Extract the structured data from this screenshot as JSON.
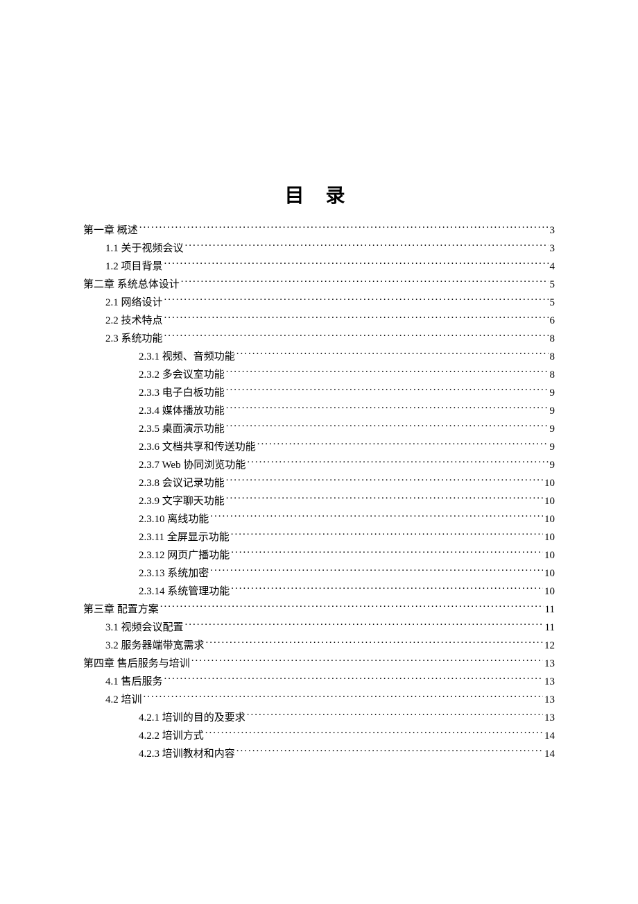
{
  "title": "目 录",
  "entries": [
    {
      "level": 0,
      "label": "第一章  概述",
      "page": "3"
    },
    {
      "level": 1,
      "label": "1.1 关于视频会议",
      "page": "3"
    },
    {
      "level": 1,
      "label": "1.2 项目背景",
      "page": "4"
    },
    {
      "level": 0,
      "label": "第二章  系统总体设计",
      "page": "5"
    },
    {
      "level": 1,
      "label": "2.1 网络设计",
      "page": "5"
    },
    {
      "level": 1,
      "label": "2.2 技术特点",
      "page": "6"
    },
    {
      "level": 1,
      "label": "2.3 系统功能",
      "page": "8"
    },
    {
      "level": 2,
      "label": "2.3.1 视频、音频功能",
      "page": "8"
    },
    {
      "level": 2,
      "label": "2.3.2 多会议室功能",
      "page": "8"
    },
    {
      "level": 2,
      "label": "2.3.3 电子白板功能",
      "page": "9"
    },
    {
      "level": 2,
      "label": "2.3.4 媒体播放功能",
      "page": "9"
    },
    {
      "level": 2,
      "label": "2.3.5 桌面演示功能",
      "page": "9"
    },
    {
      "level": 2,
      "label": "2.3.6 文档共享和传送功能",
      "page": "9"
    },
    {
      "level": 2,
      "label": "2.3.7 Web 协同浏览功能",
      "page": "9"
    },
    {
      "level": 2,
      "label": "2.3.8 会议记录功能",
      "page": "10"
    },
    {
      "level": 2,
      "label": "2.3.9 文字聊天功能",
      "page": "10"
    },
    {
      "level": 2,
      "label": "2.3.10  离线功能",
      "page": "10"
    },
    {
      "level": 2,
      "label": "2.3.11  全屏显示功能",
      "page": "10"
    },
    {
      "level": 2,
      "label": "2.3.12  网页广播功能",
      "page": "10"
    },
    {
      "level": 2,
      "label": "2.3.13  系统加密",
      "page": "10"
    },
    {
      "level": 2,
      "label": "2.3.14  系统管理功能",
      "page": "10"
    },
    {
      "level": 0,
      "label": "第三章  配置方案",
      "page": "11"
    },
    {
      "level": 1,
      "label": "3.1 视频会议配置",
      "page": "11"
    },
    {
      "level": 1,
      "label": "3.2 服务器端带宽需求",
      "page": "12"
    },
    {
      "level": 0,
      "label": "第四章  售后服务与培训",
      "page": "13"
    },
    {
      "level": 1,
      "label": "4.1 售后服务",
      "page": "13"
    },
    {
      "level": 1,
      "label": "4.2 培训",
      "page": "13"
    },
    {
      "level": 2,
      "label": "4.2.1 培训的目的及要求",
      "page": "13"
    },
    {
      "level": 2,
      "label": "4.2.2 培训方式",
      "page": "14"
    },
    {
      "level": 2,
      "label": "4.2.3 培训教材和内容",
      "page": "14"
    }
  ]
}
